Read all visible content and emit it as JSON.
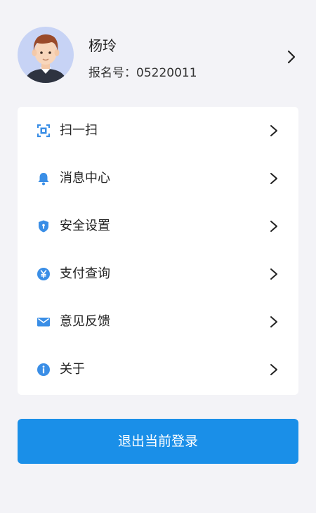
{
  "profile": {
    "name": "杨玲",
    "reg_label": "报名号：",
    "reg_number": "05220011"
  },
  "menu": [
    {
      "label": "扫一扫",
      "icon": "scan-icon"
    },
    {
      "label": "消息中心",
      "icon": "bell-icon"
    },
    {
      "label": "安全设置",
      "icon": "shield-icon"
    },
    {
      "label": "支付查询",
      "icon": "yen-icon"
    },
    {
      "label": "意见反馈",
      "icon": "mail-icon"
    },
    {
      "label": "关于",
      "icon": "info-icon"
    }
  ],
  "logout_label": "退出当前登录",
  "colors": {
    "accent": "#1a8fe8",
    "icon": "#3a8ee6",
    "background": "#f3f3f7"
  }
}
